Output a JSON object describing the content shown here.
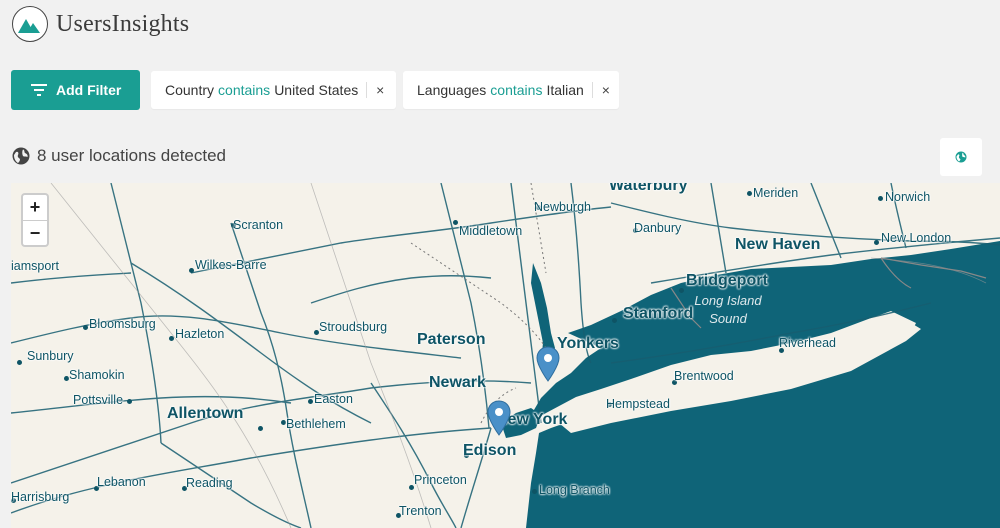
{
  "brand": {
    "name": "UsersInsights"
  },
  "toolbar": {
    "add_filter_label": "Add Filter"
  },
  "filters": [
    {
      "field": "Country",
      "operator": "contains",
      "value": "United States",
      "remove": "×"
    },
    {
      "field": "Languages",
      "operator": "contains",
      "value": "Italian",
      "remove": "×"
    }
  ],
  "locations": {
    "summary": "8 user locations detected"
  },
  "map": {
    "zoom_in": "+",
    "zoom_out": "−",
    "cities": {
      "waterbury": "Waterbury",
      "meriden": "Meriden",
      "norwich": "Norwich",
      "newburgh": "Newburgh",
      "danbury": "Danbury",
      "new_haven": "New Haven",
      "new_london": "New London",
      "scranton": "Scranton",
      "middletown": "Middletown",
      "williamsport": "iamsport",
      "wilkes_barre": "Wilkes-Barre",
      "bridgeport": "Bridgeport",
      "long_island_sound": "Long Island Sound",
      "bloomsburg": "Bloomsburg",
      "hazleton": "Hazleton",
      "stroudsburg": "Stroudsburg",
      "stamford": "Stamford",
      "paterson": "Paterson",
      "yonkers": "Yonkers",
      "riverhead": "Riverhead",
      "sunbury": "Sunbury",
      "shamokin": "Shamokin",
      "newark": "Newark",
      "brentwood": "Brentwood",
      "pottsville": "Pottsville",
      "easton": "Easton",
      "hempstead": "Hempstead",
      "allentown": "Allentown",
      "bethlehem": "Bethlehem",
      "new_york": "New York",
      "edison": "Edison",
      "lebanon": "Lebanon",
      "reading": "Reading",
      "princeton": "Princeton",
      "harrisburg": "Harrisburg",
      "long_branch": "Long Branch",
      "trenton": "Trenton"
    },
    "colors": {
      "water": "#0f6478",
      "land": "#f5f2ea",
      "road": "#175e70",
      "pin": "#4a90c8"
    }
  }
}
